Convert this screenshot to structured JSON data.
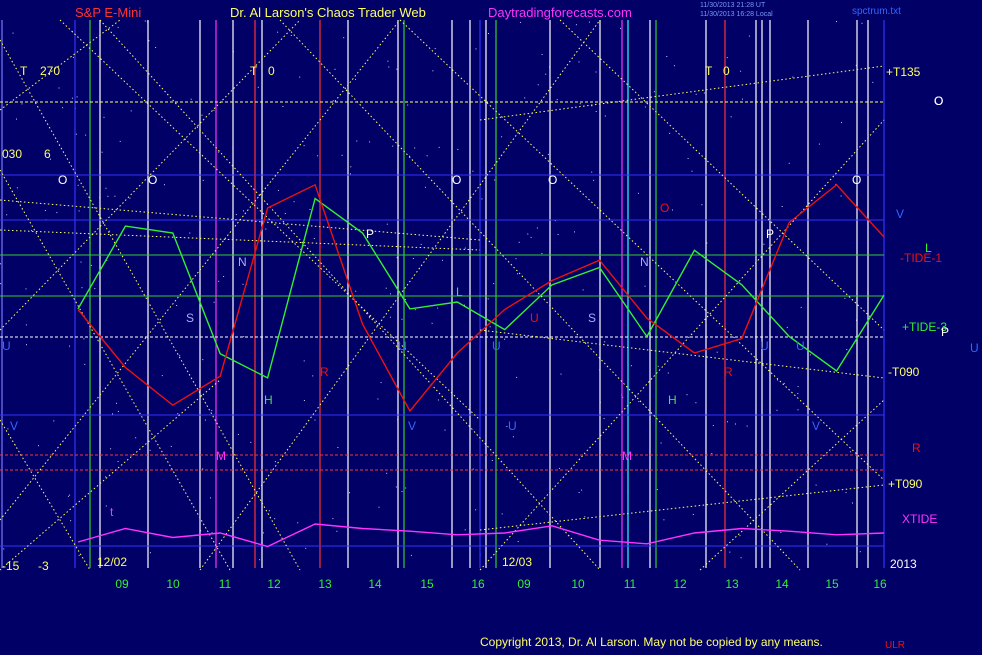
{
  "header": {
    "instrument": "S&P E-Mini",
    "title": "Dr. Al Larson's Chaos Trader Web",
    "site": "Daytradingforecasts.com",
    "timestamp_line1": "11/30/2013 21:28 UT",
    "timestamp_line2": "11/30/2013 16:28 Local",
    "file": "spctrum.txt"
  },
  "footer": {
    "copyright": "Copyright 2013, Dr. Al Larson. May not be copied by any means.",
    "corner_mark": "ULR"
  },
  "left_labels": {
    "t_label": "T",
    "t_value": "270",
    "n030": "030",
    "n6": "6",
    "n15": "-15",
    "n3": "-3"
  },
  "t_markers": [
    {
      "letter": "T",
      "value": "0"
    },
    {
      "letter": "T",
      "value": "0"
    }
  ],
  "right_labels": {
    "t135": "+T135",
    "o": "O",
    "v": "V",
    "l": "L",
    "tide1": "-TIDE-1",
    "tide3": "+TIDE-3",
    "p": "P",
    "u": "U",
    "t090m": "-T090",
    "r": "R",
    "t090p": "+T090",
    "xtide": "XTIDE",
    "year": "2013"
  },
  "week_labels": [
    "12/02",
    "12/03"
  ],
  "x_axis": {
    "tick_labels": [
      "09",
      "10",
      "11",
      "12",
      "13",
      "14",
      "15",
      "16",
      "09",
      "10",
      "11",
      "12",
      "13",
      "14",
      "15",
      "16"
    ]
  },
  "planet_markers": [
    {
      "t": "O"
    },
    {
      "t": "O"
    },
    {
      "t": "O"
    },
    {
      "t": "O"
    },
    {
      "t": "O"
    },
    {
      "t": "O"
    },
    {
      "t": "N"
    },
    {
      "t": "S"
    },
    {
      "t": "H"
    },
    {
      "t": "R"
    },
    {
      "t": "P"
    },
    {
      "t": "U"
    },
    {
      "t": "U"
    },
    {
      "t": "M"
    },
    {
      "t": "U"
    },
    {
      "t": "V"
    },
    {
      "t": "O"
    },
    {
      "t": "N"
    },
    {
      "t": "S"
    },
    {
      "t": "H"
    },
    {
      "t": "R"
    },
    {
      "t": "P"
    },
    {
      "t": "U"
    },
    {
      "t": "M"
    },
    {
      "t": "U"
    },
    {
      "t": "V"
    },
    {
      "t": "L"
    },
    {
      "t": "U"
    },
    {
      "t": "U"
    },
    {
      "t": "t"
    },
    {
      "t": "V"
    }
  ],
  "colors": {
    "background": "#000066",
    "title_red": "#ff3333",
    "title_yellow": "#ffff66",
    "site_magenta": "#ff33ff",
    "tide_green": "#33ee33",
    "tide_red": "#ee1111",
    "xtide_magenta": "#ff33ff",
    "grid_yellow": "#ffff66",
    "axis_green": "#33ee33"
  },
  "chart_data": {
    "type": "line",
    "title": "S&P E-Mini",
    "x_label": "",
    "y_label": "",
    "x": [
      "12/02 09",
      "10",
      "11",
      "12",
      "13",
      "14",
      "15",
      "16",
      "12/03 09",
      "10",
      "11",
      "12",
      "13",
      "14",
      "15",
      "16"
    ],
    "series": [
      {
        "name": "+TIDE-3",
        "values": [
          38,
          62,
          60,
          25,
          18,
          70,
          60,
          38,
          40,
          32,
          45,
          50,
          30,
          55,
          45,
          30,
          20,
          42
        ]
      },
      {
        "name": "-TIDE-1",
        "values": [
          45,
          25,
          12,
          22,
          80,
          88,
          40,
          10,
          30,
          45,
          55,
          62,
          42,
          30,
          35,
          75,
          88,
          70
        ]
      },
      {
        "name": "XTIDE",
        "values": [
          20,
          35,
          25,
          30,
          15,
          40,
          35,
          32,
          28,
          30,
          38,
          22,
          18,
          30,
          35,
          32,
          28,
          30
        ]
      }
    ]
  }
}
